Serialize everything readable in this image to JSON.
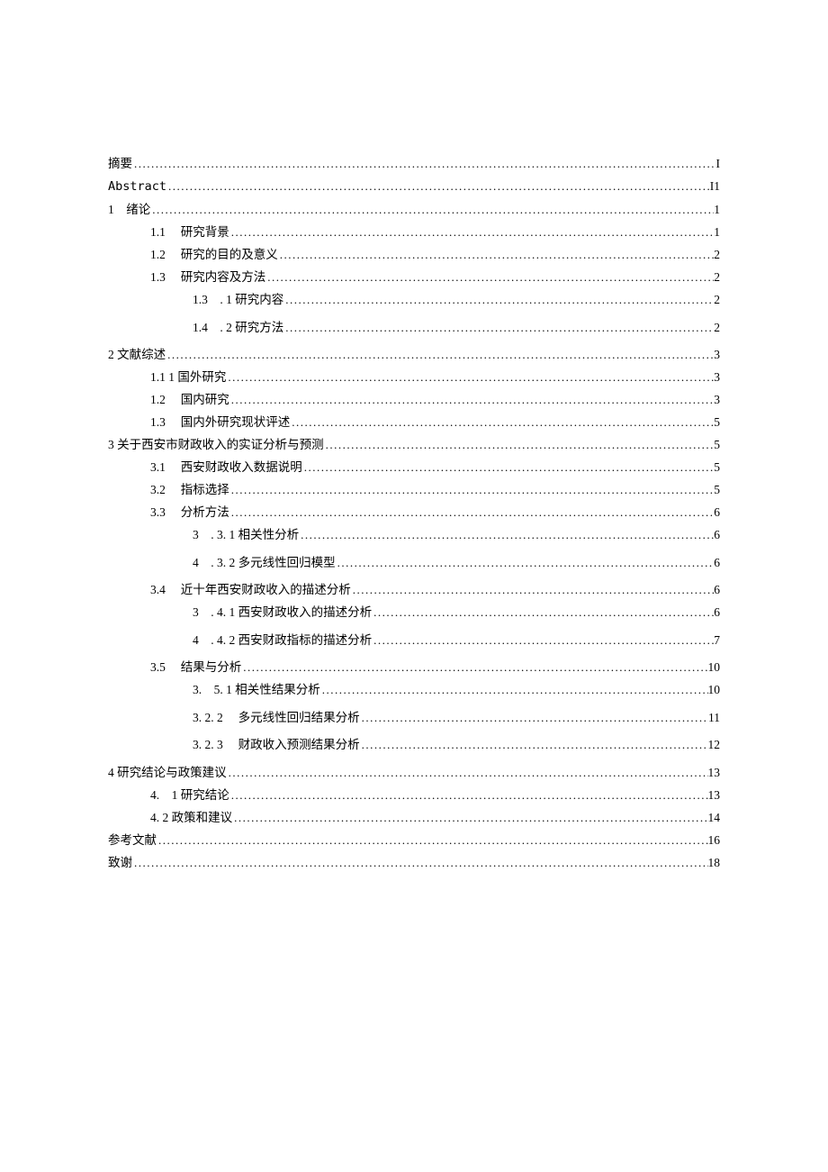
{
  "toc": [
    {
      "indent": 0,
      "label": "摘要 ",
      "page": "I",
      "extra": false
    },
    {
      "indent": 0,
      "label": "Abstract ",
      "page": "I1",
      "extra": false,
      "mono": true
    },
    {
      "indent": 0,
      "label": "1　绪论 ",
      "page": "1",
      "extra": false
    },
    {
      "indent": 1,
      "label": "1.1　 研究背景",
      "page": "1",
      "extra": false
    },
    {
      "indent": 1,
      "label": "1.2　 研究的目的及意义",
      "page": "2",
      "extra": false
    },
    {
      "indent": 1,
      "label": "1.3　 研究内容及方法",
      "page": "2",
      "extra": false
    },
    {
      "indent": 2,
      "label": "1.3　. 1 研究内容",
      "page": "2",
      "extra": true
    },
    {
      "indent": 2,
      "label": "1.4　. 2 研究方法",
      "page": "2",
      "extra": true
    },
    {
      "indent": 0,
      "label": "2 文献综述",
      "page": "3",
      "extra": false
    },
    {
      "indent": 1,
      "label": "1.1 1 国外研究 ",
      "page": "3",
      "extra": false
    },
    {
      "indent": 1,
      "label": "1.2　 国内研究",
      "page": "3",
      "extra": false
    },
    {
      "indent": 1,
      "label": "1.3　 国内外研究现状评述",
      "page": "5",
      "extra": false
    },
    {
      "indent": 0,
      "label": "3 关于西安市财政收入的实证分析与预测",
      "page": "5",
      "extra": false
    },
    {
      "indent": 1,
      "label": "3.1　 西安财政收入数据说明",
      "page": "5",
      "extra": false
    },
    {
      "indent": 1,
      "label": "3.2　 指标选择",
      "page": "5",
      "extra": false
    },
    {
      "indent": 1,
      "label": "3.3　 分析方法",
      "page": "6",
      "extra": false
    },
    {
      "indent": 2,
      "label": "3　. 3. 1 相关性分析",
      "page": "6",
      "extra": true
    },
    {
      "indent": 2,
      "label": "4　. 3. 2 多元线性回归模型",
      "page": "6",
      "extra": true
    },
    {
      "indent": 1,
      "label": "3.4　 近十年西安财政收入的描述分析",
      "page": "6",
      "extra": false
    },
    {
      "indent": 2,
      "label": "3　. 4. 1 西安财政收入的描述分析",
      "page": "6",
      "extra": true
    },
    {
      "indent": 2,
      "label": "4　. 4. 2 西安财政指标的描述分析",
      "page": "7",
      "extra": true
    },
    {
      "indent": 1,
      "label": "3.5　 结果与分析",
      "page": "10",
      "extra": false
    },
    {
      "indent": 2,
      "label": "3.　5. 1 相关性结果分析 ",
      "page": "10",
      "extra": true
    },
    {
      "indent": 2,
      "label": "3. 2. 2　 多元线性回归结果分析",
      "page": "11",
      "extra": true
    },
    {
      "indent": 2,
      "label": "3. 2. 3　 财政收入预测结果分析",
      "page": "12",
      "extra": true
    },
    {
      "indent": 0,
      "label": "4 研究结论与政策建议",
      "page": "13",
      "extra": false
    },
    {
      "indent": 1,
      "label": "4.　1 研究结论 ",
      "page": "13",
      "extra": false
    },
    {
      "indent": 1,
      "label": "4. 2 政策和建议",
      "page": "14",
      "extra": false
    },
    {
      "indent": 0,
      "label": "参考文献 ",
      "page": "16",
      "extra": false
    },
    {
      "indent": 0,
      "label": "致谢 ",
      "page": "18",
      "extra": false
    }
  ]
}
